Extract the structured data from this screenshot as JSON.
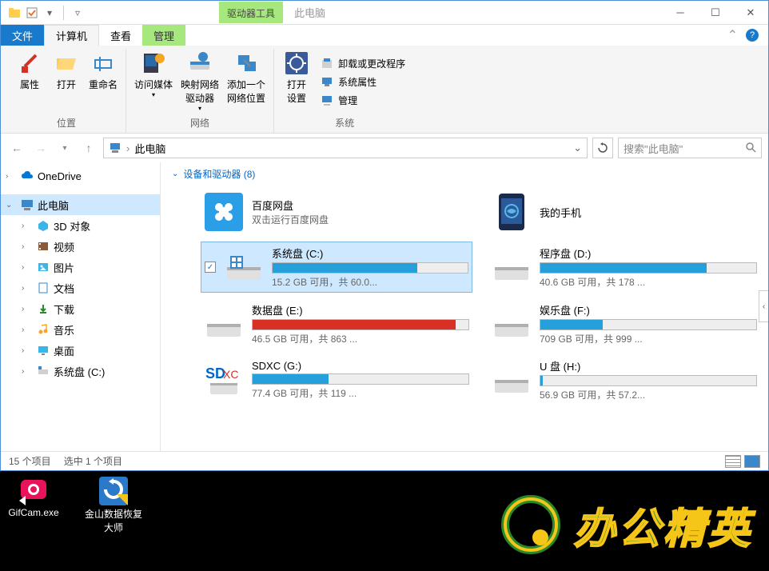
{
  "titlebar": {
    "contextual_tab": "驱动器工具",
    "title": "此电脑"
  },
  "menu": {
    "file": "文件",
    "computer": "计算机",
    "view": "查看",
    "manage": "管理"
  },
  "ribbon": {
    "properties": "属性",
    "open": "打开",
    "rename": "重命名",
    "location_group": "位置",
    "access_media": "访问媒体",
    "map_drive": "映射网络\n驱动器",
    "add_location": "添加一个\n网络位置",
    "network_group": "网络",
    "open_settings": "打开\n设置",
    "uninstall": "卸载或更改程序",
    "sys_properties": "系统属性",
    "manage": "管理",
    "system_group": "系统"
  },
  "address": {
    "path": "此电脑",
    "search_placeholder": "搜索\"此电脑\""
  },
  "sidebar": {
    "onedrive": "OneDrive",
    "this_pc": "此电脑",
    "objects_3d": "3D 对象",
    "videos": "视频",
    "pictures": "图片",
    "documents": "文档",
    "downloads": "下载",
    "music": "音乐",
    "desktop": "桌面",
    "system_drive": "系统盘 (C:)"
  },
  "section": {
    "devices_header": "设备和驱动器 (8)"
  },
  "items": {
    "baidu": {
      "title": "百度网盘",
      "sub": "双击运行百度网盘"
    },
    "phone": {
      "title": "我的手机",
      "sub": ""
    },
    "c": {
      "title": "系统盘 (C:)",
      "free": "15.2 GB 可用，共 60.0...",
      "fill": 74,
      "color": "blue"
    },
    "d": {
      "title": "程序盘 (D:)",
      "free": "40.6 GB 可用，共 178 ...",
      "fill": 77,
      "color": "blue"
    },
    "e": {
      "title": "数据盘 (E:)",
      "free": "46.5 GB 可用，共 863 ...",
      "fill": 94,
      "color": "red"
    },
    "f": {
      "title": "娱乐盘 (F:)",
      "free": "709 GB 可用，共 999 ...",
      "fill": 29,
      "color": "blue"
    },
    "g": {
      "title": "SDXC (G:)",
      "free": "77.4 GB 可用，共 119 ...",
      "fill": 35,
      "color": "blue"
    },
    "h": {
      "title": "U 盘 (H:)",
      "free": "56.9 GB 可用，共 57.2...",
      "fill": 1,
      "color": "blue"
    }
  },
  "status": {
    "count": "15 个项目",
    "selected": "选中 1 个项目"
  },
  "desktop": {
    "gifcam": "GifCam.exe",
    "kingsoft": "金山数据恢复\n大师"
  },
  "watermark": "办公精英"
}
